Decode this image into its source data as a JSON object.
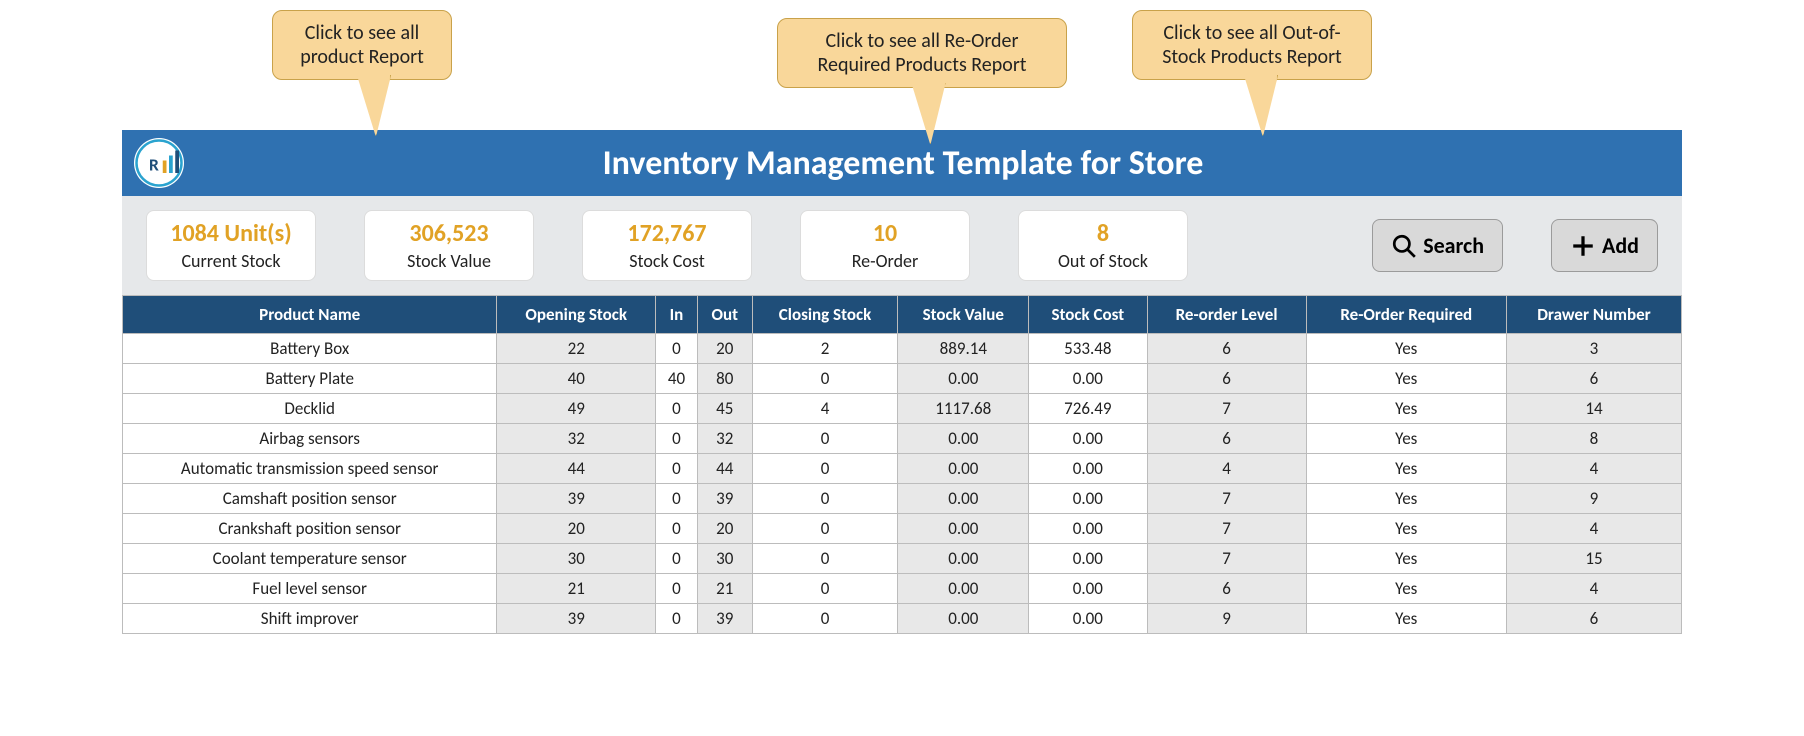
{
  "callouts": {
    "product": "Click to see all product Report",
    "reorder": "Click to see all Re-Order Required Products Report",
    "outofstock": "Click to see all Out-of-Stock Products Report"
  },
  "header": {
    "title": "Inventory Management Template for Store"
  },
  "kpis": {
    "current_stock": {
      "value": "1084 Unit(s)",
      "label": "Current Stock"
    },
    "stock_value": {
      "value": "306,523",
      "label": "Stock Value"
    },
    "stock_cost": {
      "value": "172,767",
      "label": "Stock Cost"
    },
    "reorder": {
      "value": "10",
      "label": "Re-Order"
    },
    "out_of_stock": {
      "value": "8",
      "label": "Out of Stock"
    }
  },
  "buttons": {
    "search": "Search",
    "add": "Add"
  },
  "table": {
    "columns": [
      "Product Name",
      "Opening Stock",
      "In",
      "Out",
      "Closing Stock",
      "Stock Value",
      "Stock Cost",
      "Re-order Level",
      "Re-Order Required",
      "Drawer Number"
    ],
    "rows": [
      [
        "Battery Box",
        "22",
        "0",
        "20",
        "2",
        "889.14",
        "533.48",
        "6",
        "Yes",
        "3"
      ],
      [
        "Battery Plate",
        "40",
        "40",
        "80",
        "0",
        "0.00",
        "0.00",
        "6",
        "Yes",
        "6"
      ],
      [
        "Decklid",
        "49",
        "0",
        "45",
        "4",
        "1117.68",
        "726.49",
        "7",
        "Yes",
        "14"
      ],
      [
        "Airbag sensors",
        "32",
        "0",
        "32",
        "0",
        "0.00",
        "0.00",
        "6",
        "Yes",
        "8"
      ],
      [
        "Automatic transmission speed sensor",
        "44",
        "0",
        "44",
        "0",
        "0.00",
        "0.00",
        "4",
        "Yes",
        "4"
      ],
      [
        "Camshaft position sensor",
        "39",
        "0",
        "39",
        "0",
        "0.00",
        "0.00",
        "7",
        "Yes",
        "9"
      ],
      [
        "Crankshaft position sensor",
        "20",
        "0",
        "20",
        "0",
        "0.00",
        "0.00",
        "7",
        "Yes",
        "4"
      ],
      [
        "Coolant temperature sensor",
        "30",
        "0",
        "30",
        "0",
        "0.00",
        "0.00",
        "7",
        "Yes",
        "15"
      ],
      [
        "Fuel level sensor",
        "21",
        "0",
        "21",
        "0",
        "0.00",
        "0.00",
        "6",
        "Yes",
        "4"
      ],
      [
        "Shift improver",
        "39",
        "0",
        "39",
        "0",
        "0.00",
        "0.00",
        "9",
        "Yes",
        "6"
      ]
    ]
  }
}
